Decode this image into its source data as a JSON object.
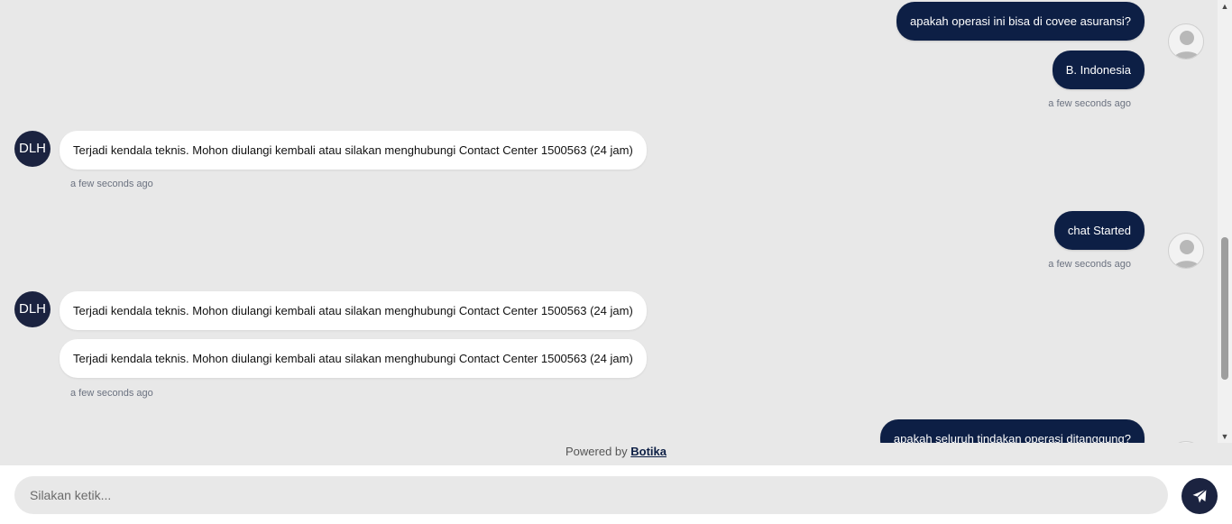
{
  "colors": {
    "user_bubble": "#0d1f45",
    "bot_bubble": "#ffffff",
    "background": "#e8e8e8",
    "bot_avatar": "#1b2340",
    "send_button": "#1b2340"
  },
  "bot": {
    "avatar_initials": "DLH"
  },
  "messages": [
    {
      "sender": "user",
      "text": "apakah operasi ini bisa di covee asuransi?"
    },
    {
      "sender": "user",
      "text": "B. Indonesia",
      "time": "a few seconds ago"
    },
    {
      "sender": "bot",
      "text": "Terjadi kendala teknis. Mohon diulangi kembali atau silakan menghubungi Contact Center 1500563 (24 jam)",
      "time": "a few seconds ago"
    },
    {
      "sender": "user",
      "text": "chat Started",
      "time": "a few seconds ago"
    },
    {
      "sender": "bot",
      "text": "Terjadi kendala teknis. Mohon diulangi kembali atau silakan menghubungi Contact Center 1500563 (24 jam)"
    },
    {
      "sender": "bot",
      "text": "Terjadi kendala teknis. Mohon diulangi kembali atau silakan menghubungi Contact Center 1500563 (24 jam)",
      "time": "a few seconds ago"
    },
    {
      "sender": "user",
      "text": "apakah seluruh tindakan operasi ditanggung?"
    }
  ],
  "footer": {
    "powered_prefix": "Powered by",
    "brand": "Botika"
  },
  "composer": {
    "placeholder": "Silakan ketik...",
    "value": ""
  },
  "icons": {
    "user_avatar": "user-silhouette-icon",
    "send": "paper-plane-icon",
    "scroll_up": "triangle-up-icon",
    "scroll_down": "triangle-down-icon"
  }
}
